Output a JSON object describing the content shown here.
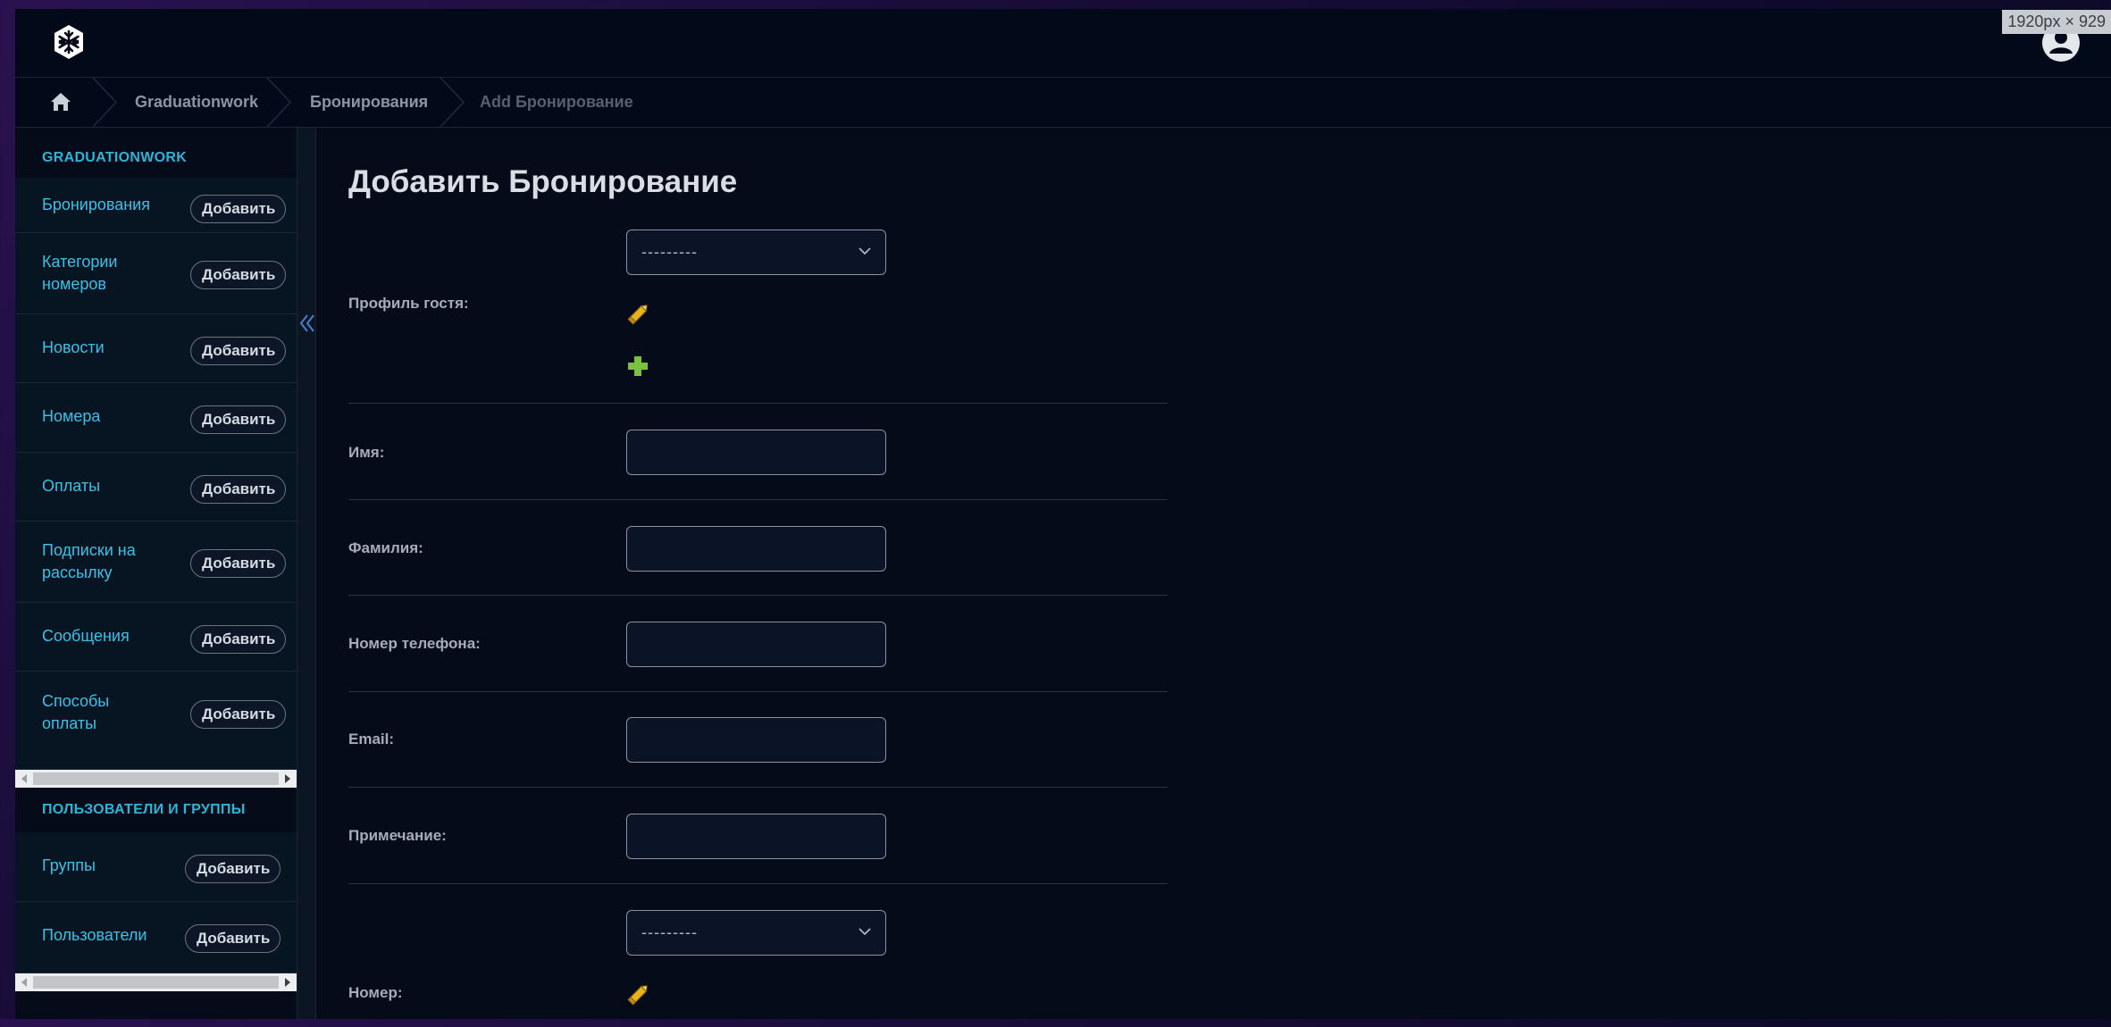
{
  "header": {
    "logo_icon": "snowflake-logo-icon",
    "size_badge": "1920px × 929",
    "user_icon": "user-avatar-icon"
  },
  "breadcrumbs": {
    "home_icon": "home-icon",
    "items": [
      "Graduationwork",
      "Бронирования",
      "Add Бронирование"
    ]
  },
  "sidebar": {
    "modules": [
      {
        "title": "GRADUATIONWORK",
        "items": [
          {
            "label": "Бронирования",
            "add": "Добавить"
          },
          {
            "label": "Категории номеров",
            "add": "Добавить"
          },
          {
            "label": "Новости",
            "add": "Добавить"
          },
          {
            "label": "Номера",
            "add": "Добавить"
          },
          {
            "label": "Оплаты",
            "add": "Добавить"
          },
          {
            "label": "Подписки на рассылку",
            "add": "Добавить"
          },
          {
            "label": "Сообщения",
            "add": "Добавить"
          },
          {
            "label": "Способы оплаты",
            "add": "Добавить"
          }
        ]
      },
      {
        "title": "ПОЛЬЗОВАТЕЛИ И ГРУППЫ",
        "items": [
          {
            "label": "Группы",
            "add": "Добавить"
          },
          {
            "label": "Пользователи",
            "add": "Добавить"
          }
        ]
      }
    ],
    "collapse_icon": "double-chevron-left-icon"
  },
  "main": {
    "title": "Добавить Бронирование",
    "fields": {
      "guest_profile": {
        "label": "Профиль гостя:",
        "value": "---------"
      },
      "first_name": {
        "label": "Имя:",
        "value": ""
      },
      "last_name": {
        "label": "Фамилия:",
        "value": ""
      },
      "phone": {
        "label": "Номер телефона:",
        "value": ""
      },
      "email": {
        "label": "Email:",
        "value": ""
      },
      "note": {
        "label": "Примечание:",
        "value": ""
      },
      "room": {
        "label": "Номер:",
        "value": "---------"
      }
    }
  },
  "colors": {
    "background": "#050b18",
    "accent": "#3cc1e6",
    "edit": "#e8b21c",
    "add": "#7ac142"
  }
}
